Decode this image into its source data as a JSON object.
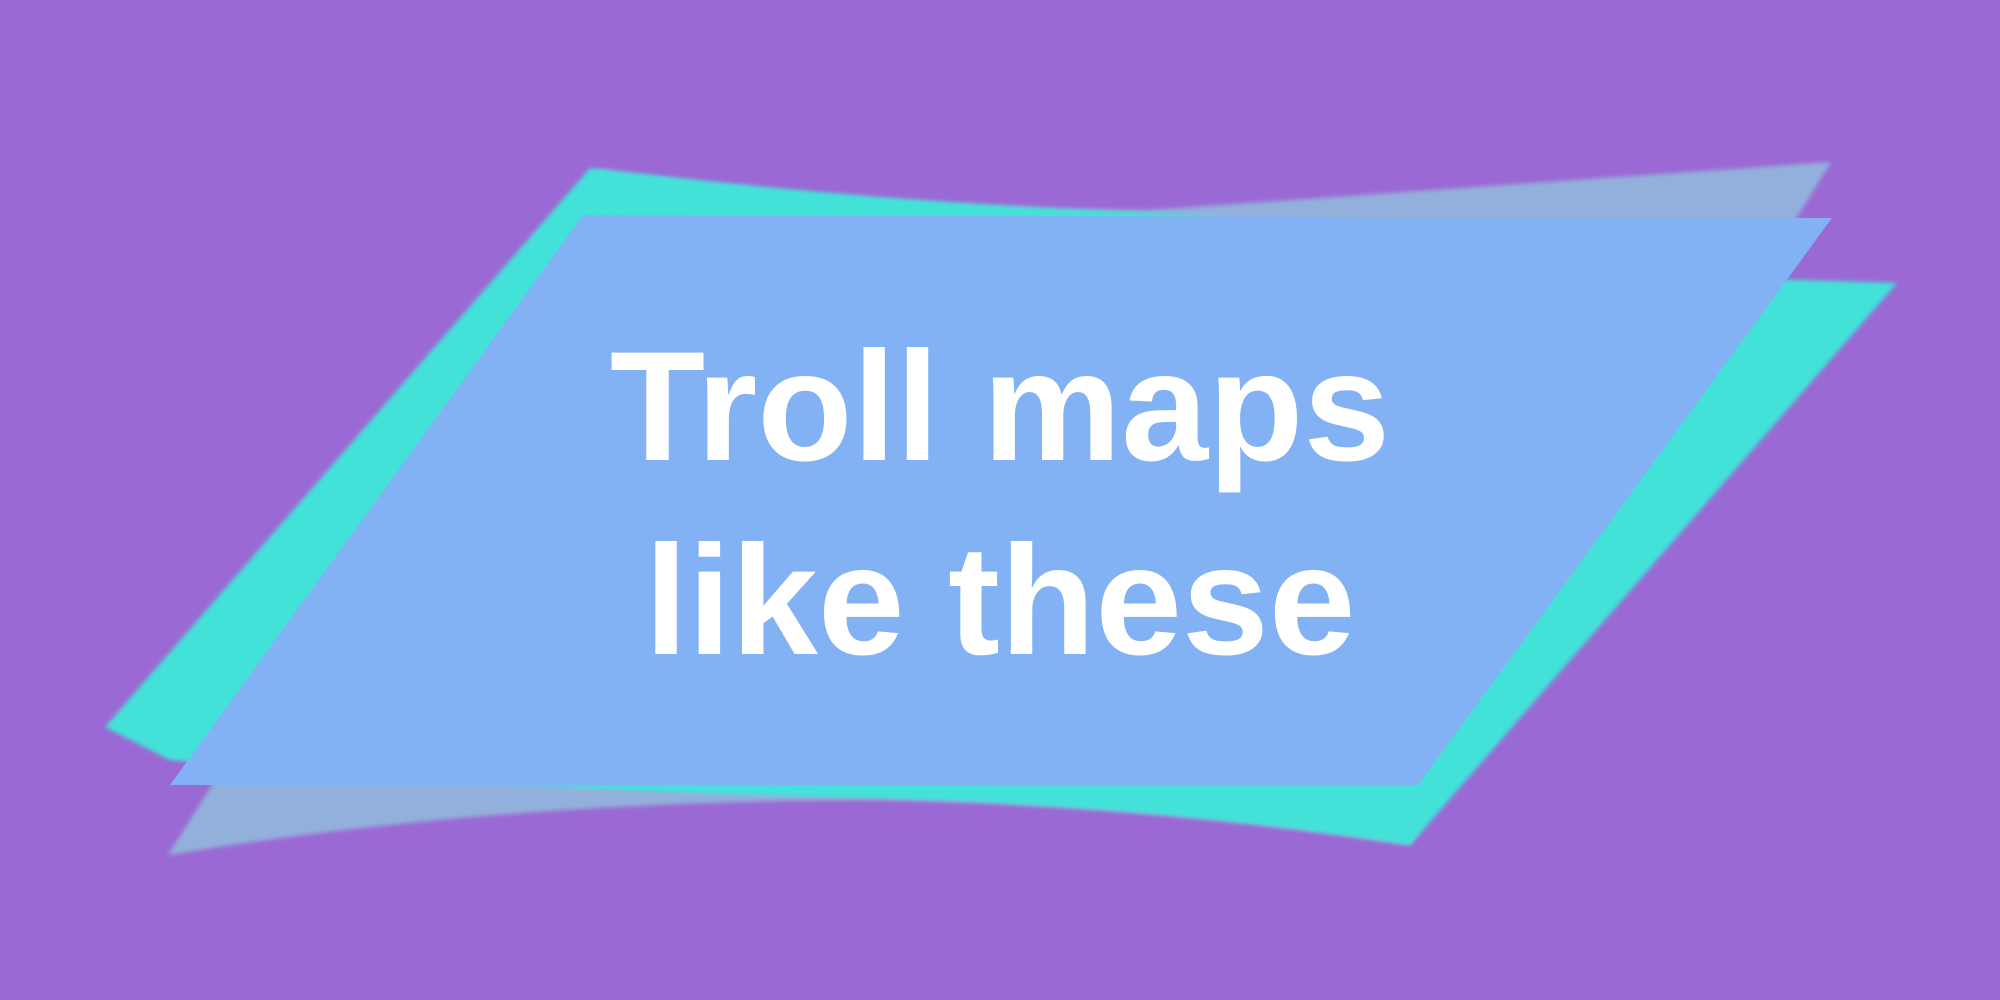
{
  "banner": {
    "line1": "Troll maps",
    "line2": "like these"
  },
  "colors": {
    "background": "#9b69d4",
    "back_panel": "#93b0dc",
    "mid_panel": "#43e2d9",
    "front_panel": "#82b2f3",
    "text": "#ffffff"
  }
}
